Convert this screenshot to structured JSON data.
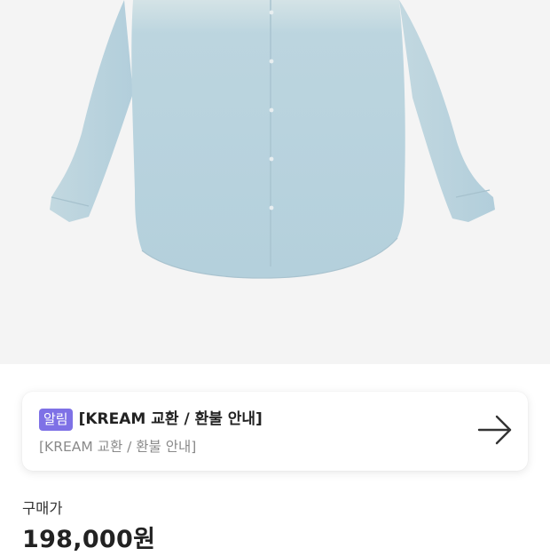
{
  "product": {
    "image_icon": "denim-shirt-image",
    "image_background": "#f4f4f4",
    "shirt_color": "#b9d3de"
  },
  "notice": {
    "badge": "알림",
    "badge_color": "#7e71e6",
    "title": "[KREAM 교환 / 환불 안내]",
    "subtitle": "[KREAM 교환 / 환불 안내]",
    "arrow_icon": "arrow-right-icon"
  },
  "price": {
    "label": "구매가",
    "value": "198,000원"
  }
}
